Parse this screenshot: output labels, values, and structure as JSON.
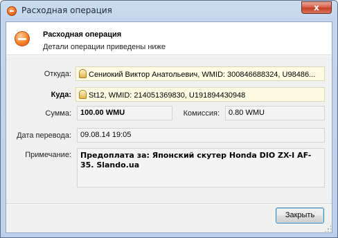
{
  "window": {
    "title": "Расходная операция",
    "close_glyph": "x",
    "app_icon": "minus-circle-icon"
  },
  "header": {
    "title": "Расходная операция",
    "subtitle": "Детали операции приведены ниже",
    "icon": "minus-circle-icon"
  },
  "form": {
    "from_label": "Откуда:",
    "from_value": "Сениокий Виктор Анатольевич, WMID: 300846688324, U98486...",
    "to_label": "Куда:",
    "to_value": "St12, WMID: 214051369830, U191894430948",
    "amount_label": "Сумма:",
    "amount_value": "100.00 WMU",
    "fee_label": "Комиссия:",
    "fee_value": "0.80 WMU",
    "date_label": "Дата перевода:",
    "date_value": "09.08.14 19:05",
    "note_label": "Примечание:",
    "note_value": "Предоплата за: Японский скутер Honda DIO ZX-I AF-35. Slando.ua"
  },
  "footer": {
    "close_label": "Закрыть"
  },
  "colors": {
    "accent": "#f26b1d",
    "highlight_field": "#fdfbe2",
    "button_border": "#3c7fb1"
  }
}
